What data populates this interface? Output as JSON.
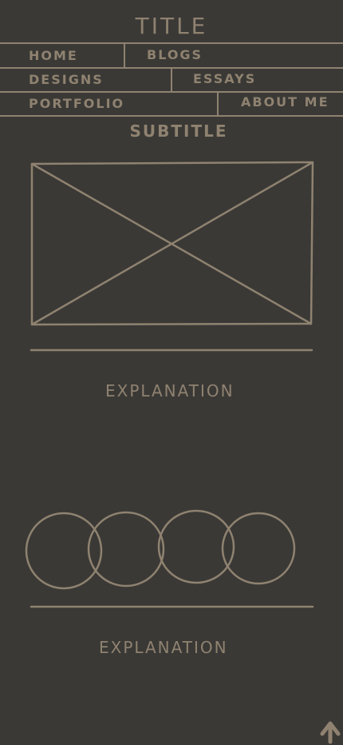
{
  "page": {
    "title": "TITLE",
    "subtitle": "SUBTITLE",
    "ink_color": "#8f8270",
    "background_color": "#3a3936"
  },
  "nav": {
    "items": [
      {
        "label": "HOME"
      },
      {
        "label": "BLOGS"
      },
      {
        "label": "DESIGNS"
      },
      {
        "label": "ESSAYS"
      },
      {
        "label": "PORTFOLIO"
      },
      {
        "label": "ABOUT ME"
      }
    ]
  },
  "sections": [
    {
      "placeholder": "image-placeholder",
      "explanation": "EXPLANATION"
    },
    {
      "placeholder": "four-overlapping-circles",
      "explanation": "EXPLANATION"
    }
  ],
  "icons": {
    "scroll_top": "arrow-up-icon"
  }
}
